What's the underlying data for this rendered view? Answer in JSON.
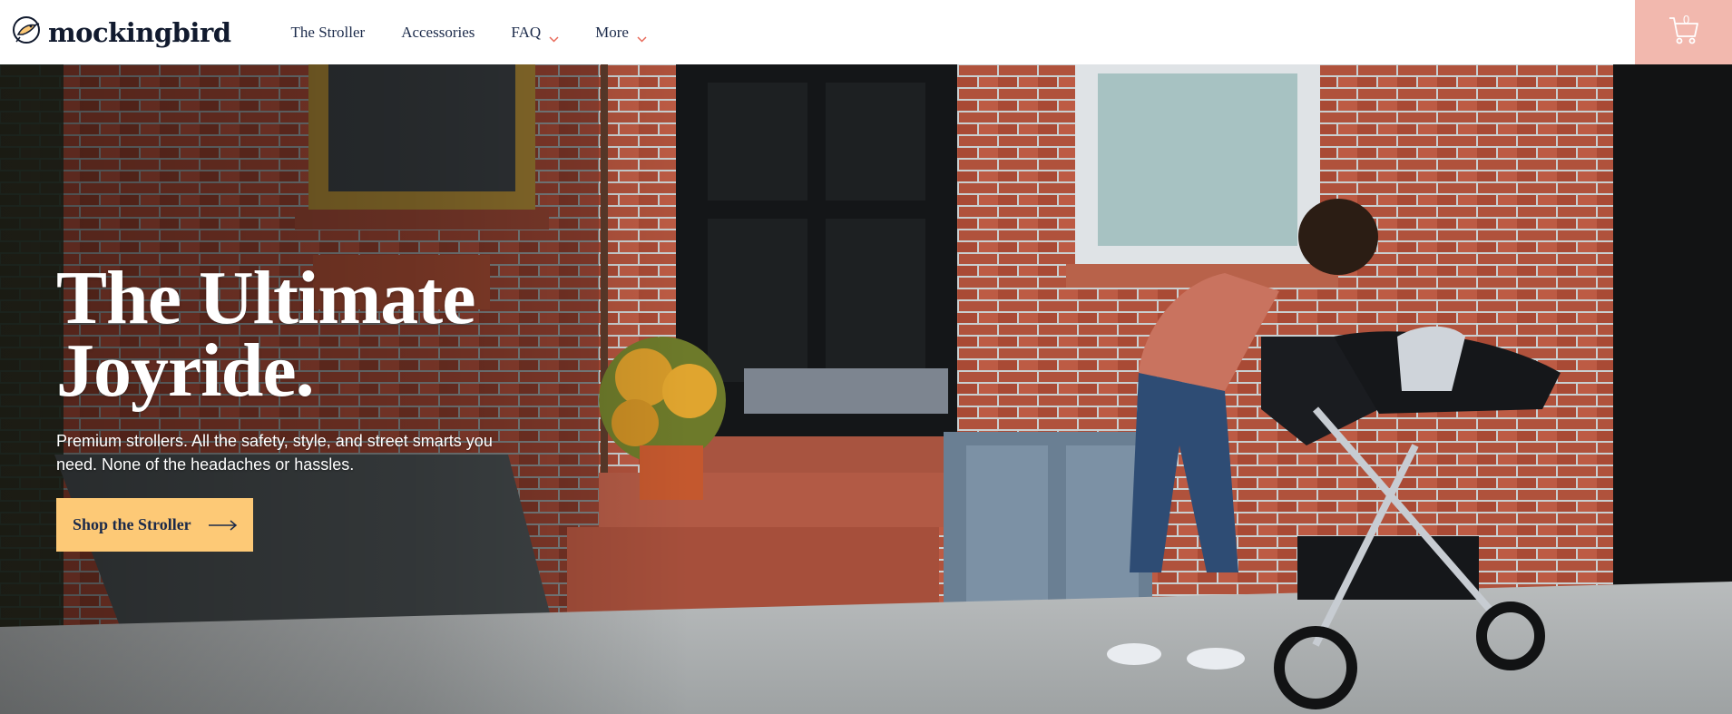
{
  "brand": {
    "name": "mockingbird",
    "logo_icon": "bird-icon"
  },
  "nav": {
    "items": [
      {
        "label": "The Stroller",
        "has_dropdown": false
      },
      {
        "label": "Accessories",
        "has_dropdown": false
      },
      {
        "label": "FAQ",
        "has_dropdown": true
      },
      {
        "label": "More",
        "has_dropdown": true
      }
    ]
  },
  "cart": {
    "icon": "cart-icon",
    "count": "0"
  },
  "hero": {
    "title": "The Ultimate Joyride.",
    "subtitle": "Premium strollers. All the safety, style, and street smarts you need. None of the headaches or hassles.",
    "cta_label": "Shop the Stroller",
    "cta_icon": "arrow-right-icon"
  },
  "colors": {
    "brand_navy": "#1b2a4a",
    "cart_background": "#f2b8ae",
    "cta_background": "#fdc976",
    "chevron_accent": "#e86a5a",
    "brick": "#b0523c"
  }
}
